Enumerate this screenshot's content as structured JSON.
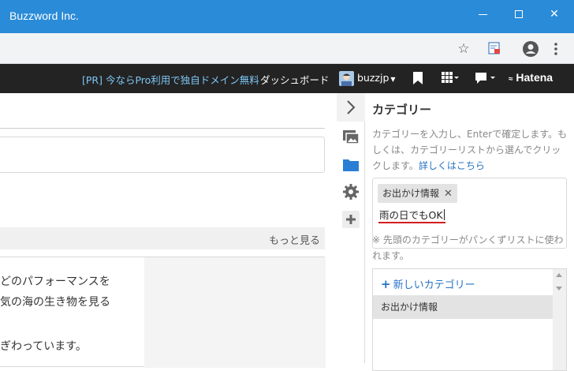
{
  "window": {
    "title": "Buzzword Inc."
  },
  "hatena_bar": {
    "pr_link": "[PR] 今ならPro利用で独自ドメイン無料",
    "dashboard": "ダッシュボード",
    "username": "buzzjp",
    "logo": "Hatena"
  },
  "editor": {
    "more_link": "もっと見る",
    "content_lines": [
      "どのパフォーマンスを",
      "気の海の生き物を見る",
      "ぎわっています。"
    ]
  },
  "category_panel": {
    "title": "カテゴリー",
    "description": "カテゴリーを入力し、Enterで確定します。もしくは、カテゴリーリストから選んでクリックします。",
    "details_link": "詳しくはこちら",
    "selected_tag": "お出かけ情報",
    "input_value": "雨の日でもOK",
    "note": "※ 先頭のカテゴリーがパンくずリストに使われます。",
    "new_category_button": "新しいカテゴリー",
    "list_items": [
      "お出かけ情報"
    ]
  }
}
